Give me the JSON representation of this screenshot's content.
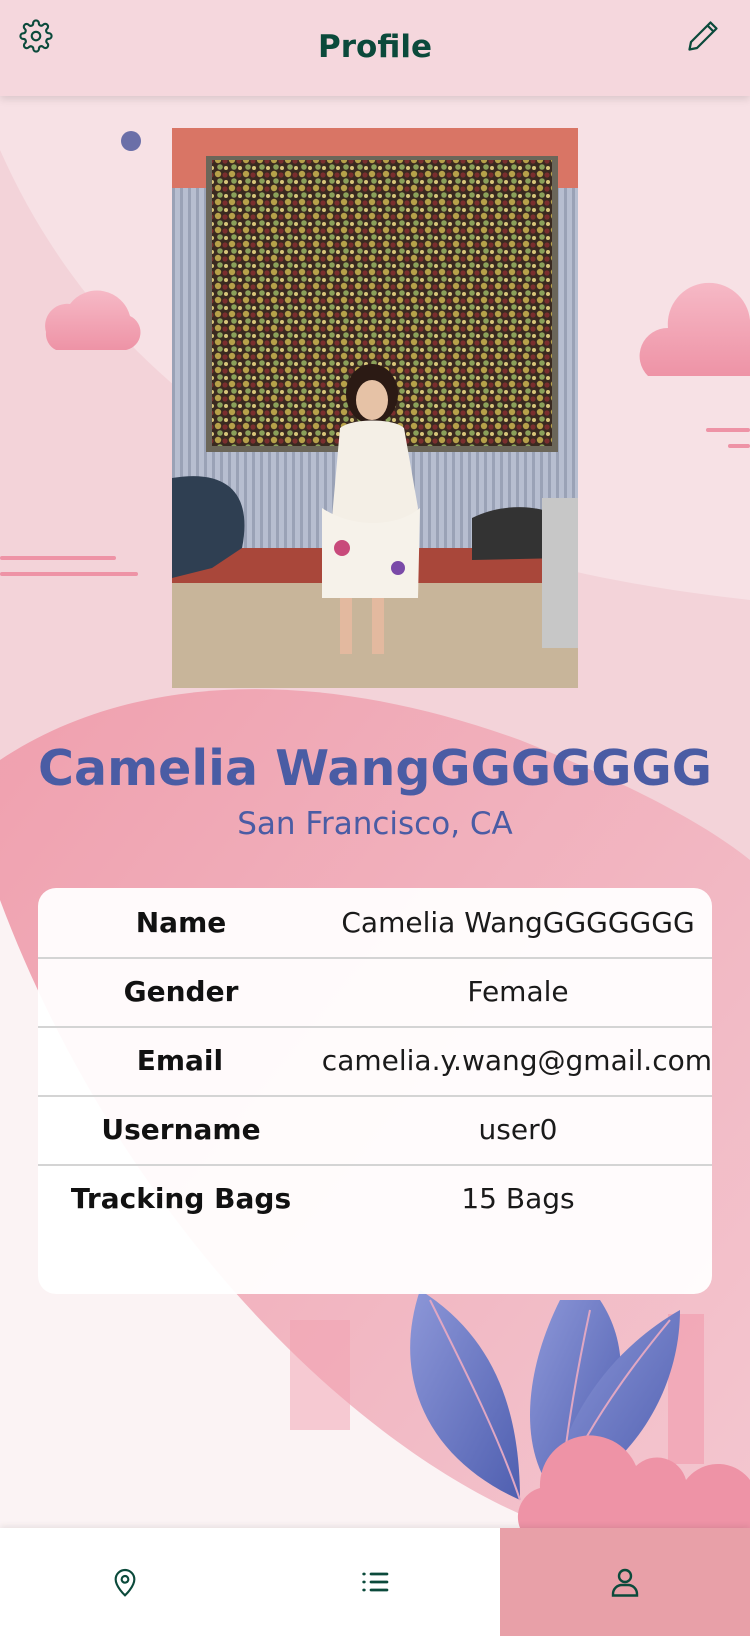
{
  "header": {
    "title": "Profile",
    "settings_icon": "gear-icon",
    "edit_icon": "pencil-icon"
  },
  "profile": {
    "photo_alt": "Profile photo",
    "name": "Camelia WangGGGGGGG",
    "location": "San Francisco, CA"
  },
  "details": [
    {
      "label": "Name",
      "value": "Camelia WangGGGGGGG"
    },
    {
      "label": "Gender",
      "value": "Female"
    },
    {
      "label": "Email",
      "value": "camelia.y.wang@gmail.com"
    },
    {
      "label": "Username",
      "value": "user0"
    },
    {
      "label": "Tracking Bags",
      "value": "15 Bags"
    }
  ],
  "nav": {
    "items": [
      {
        "icon": "map-pin-icon",
        "active": false
      },
      {
        "icon": "list-icon",
        "active": false
      },
      {
        "icon": "user-icon",
        "active": true
      }
    ]
  },
  "colors": {
    "accent_green": "#0b4a3b",
    "accent_blue": "#4a5ca4",
    "pink": "#e8a0a8",
    "background": "#f3d3d9"
  }
}
